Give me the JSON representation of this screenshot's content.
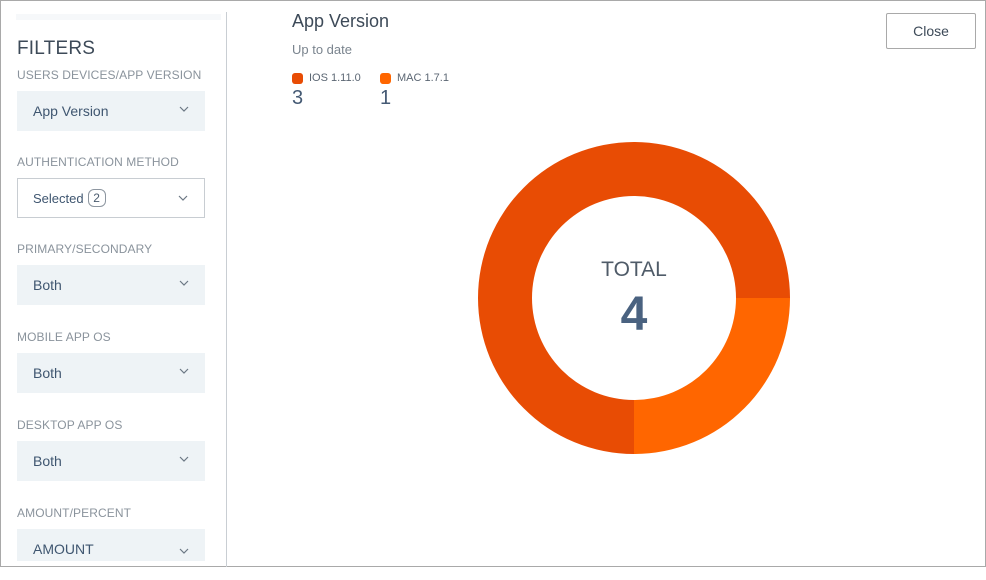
{
  "sidebar": {
    "title": "FILTERS",
    "filters": [
      {
        "label": "USERS DEVICES/APP VERSION",
        "value": "App Version"
      },
      {
        "label": "AUTHENTICATION METHOD",
        "value": "Selected",
        "badge": "2"
      },
      {
        "label": "PRIMARY/SECONDARY",
        "value": "Both"
      },
      {
        "label": "MOBILE APP OS",
        "value": "Both"
      },
      {
        "label": "DESKTOP APP OS",
        "value": "Both"
      },
      {
        "label": "AMOUNT/PERCENT",
        "value": "AMOUNT"
      }
    ]
  },
  "header": {
    "title": "App Version",
    "subtitle": "Up to date",
    "close_label": "Close"
  },
  "chart_data": {
    "type": "pie",
    "variant": "donut",
    "title": "App Version",
    "subtitle": "Up to date",
    "categories": [
      "IOS 1.11.0",
      "MAC 1.7.1"
    ],
    "values": [
      3,
      1
    ],
    "colors": [
      "#e84c04",
      "#ff6600"
    ],
    "legend_position": "top-left",
    "center_label": "TOTAL",
    "center_value": "4"
  }
}
